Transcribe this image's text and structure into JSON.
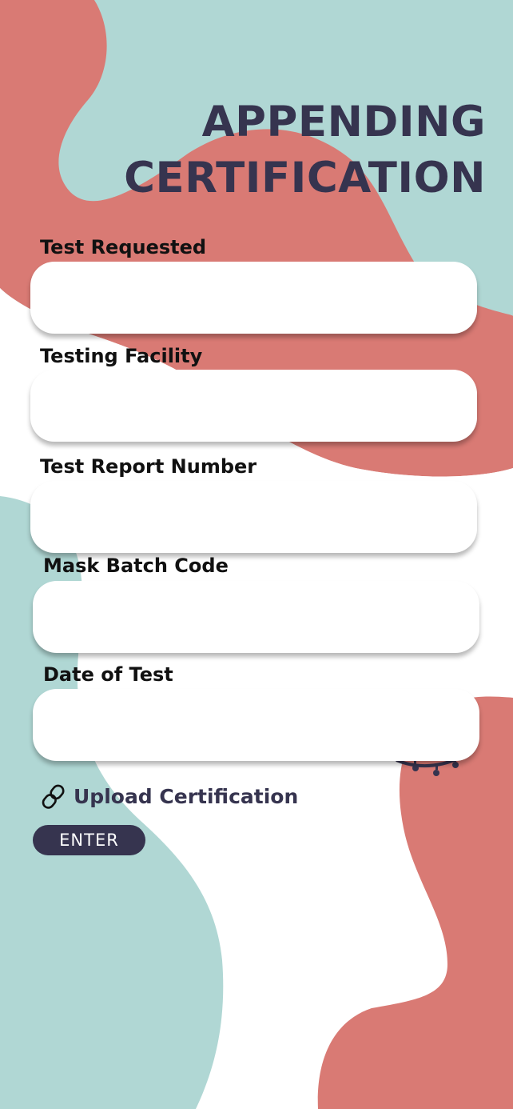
{
  "header": {
    "title_line1": "APPENDING",
    "title_line2": "CERTIFICATION"
  },
  "form": {
    "fields": [
      {
        "label": "Test Requested",
        "value": "",
        "placeholder": ""
      },
      {
        "label": "Testing Facility",
        "value": "",
        "placeholder": ""
      },
      {
        "label": "Test Report Number",
        "value": "",
        "placeholder": ""
      },
      {
        "label": "Mask Batch Code",
        "value": "",
        "placeholder": ""
      },
      {
        "label": "Date of Test",
        "value": "",
        "placeholder": ""
      }
    ],
    "upload": {
      "label": "Upload Certification",
      "icon": "link-icon"
    },
    "submit_label": "ENTER"
  },
  "colors": {
    "coral": "#d97a74",
    "teal": "#b0d7d4",
    "navy": "#36344f",
    "white": "#ffffff"
  }
}
